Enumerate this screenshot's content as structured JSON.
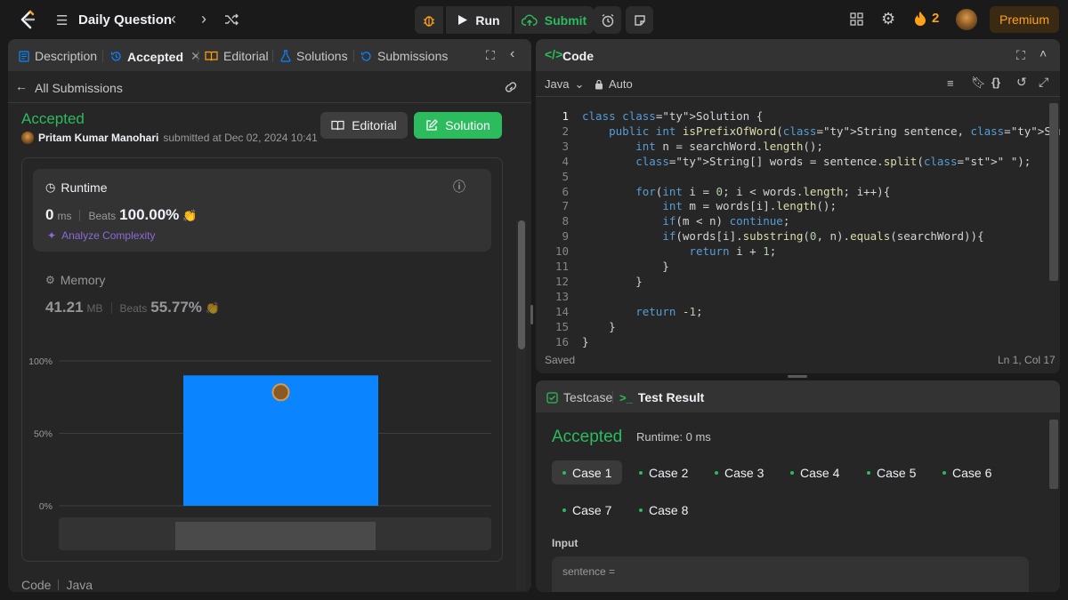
{
  "topbar": {
    "title": "Daily Question",
    "run_label": "Run",
    "submit_label": "Submit",
    "streak_count": "2",
    "premium_label": "Premium"
  },
  "left": {
    "tabs": [
      "Description",
      "Accepted",
      "Editorial",
      "Solutions",
      "Submissions"
    ],
    "all_submissions": "All Submissions",
    "status": "Accepted",
    "author": "Pritam Kumar Manohari",
    "submitted_at": "submitted at Dec 02, 2024 10:41",
    "editorial_button": "Editorial",
    "solution_button": "Solution",
    "runtime": {
      "label": "Runtime",
      "value": "0",
      "unit": "ms",
      "beats_label": "Beats",
      "beats_value": "100.00%",
      "analyze": "Analyze Complexity"
    },
    "memory": {
      "label": "Memory",
      "value": "41.21",
      "unit": "MB",
      "beats_label": "Beats",
      "beats_value": "55.77%"
    },
    "code_label": "Code",
    "code_lang": "Java"
  },
  "chart_data": {
    "type": "bar",
    "y_ticks": [
      "100%",
      "50%",
      "0%"
    ],
    "ylim": [
      0,
      100
    ],
    "values": [
      90
    ],
    "grid": true
  },
  "code_panel": {
    "title": "Code",
    "language": "Java",
    "autosave": "Auto",
    "status_saved": "Saved",
    "cursor": "Ln 1, Col 17",
    "line_numbers": [
      "1",
      "2",
      "3",
      "4",
      "5",
      "6",
      "7",
      "8",
      "9",
      "10",
      "11",
      "12",
      "13",
      "14",
      "15",
      "16"
    ],
    "lines": [
      "class Solution {",
      "    public int isPrefixOfWord(String sentence, String searchWord) {",
      "        int n = searchWord.length();",
      "        String[] words = sentence.split(\" \");",
      "",
      "        for(int i = 0; i < words.length; i++){",
      "            int m = words[i].length();",
      "            if(m < n) continue;",
      "            if(words[i].substring(0, n).equals(searchWord)){",
      "                return i + 1;",
      "            }",
      "        }",
      "",
      "        return -1;",
      "    }",
      "}"
    ]
  },
  "result_panel": {
    "tab_testcase": "Testcase",
    "tab_result": "Test Result",
    "status": "Accepted",
    "runtime": "Runtime: 0 ms",
    "cases": [
      "Case 1",
      "Case 2",
      "Case 3",
      "Case 4",
      "Case 5",
      "Case 6",
      "Case 7",
      "Case 8"
    ],
    "input_label": "Input",
    "input_param": "sentence ="
  },
  "colors": {
    "accent_green": "#2cbb5d",
    "accent_orange": "#ffa116",
    "bar_blue": "#0a84ff"
  }
}
